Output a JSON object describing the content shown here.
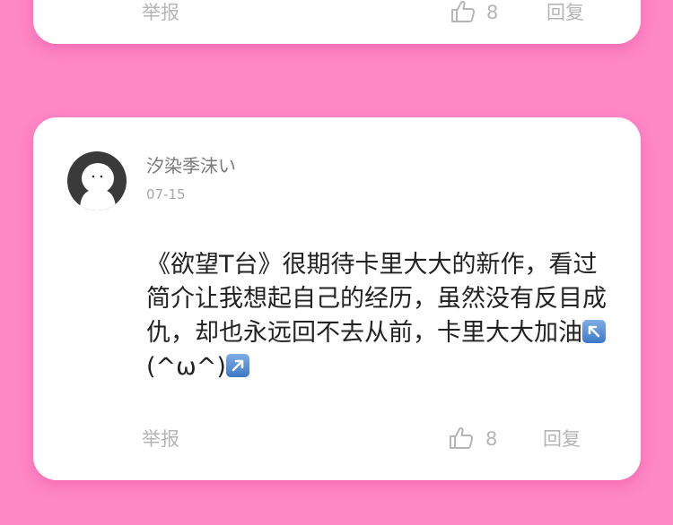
{
  "previous_comment": {
    "report_label": "举报",
    "like_count": "8",
    "reply_label": "回复"
  },
  "comment": {
    "username": "汐染季沫い",
    "date": "07-15",
    "text_part1": "《欲望T台》很期待卡里大大的新作，看过简介让我想起自己的经历，虽然没有反目成仇，却也永远回不去从前，卡里大大加油",
    "text_part2": "(^ω^)",
    "report_label": "举报",
    "like_count": "8",
    "reply_label": "回复"
  },
  "colors": {
    "background": "#fe87c5",
    "card": "#ffffff",
    "emoji_box": "#5a8fd6"
  }
}
